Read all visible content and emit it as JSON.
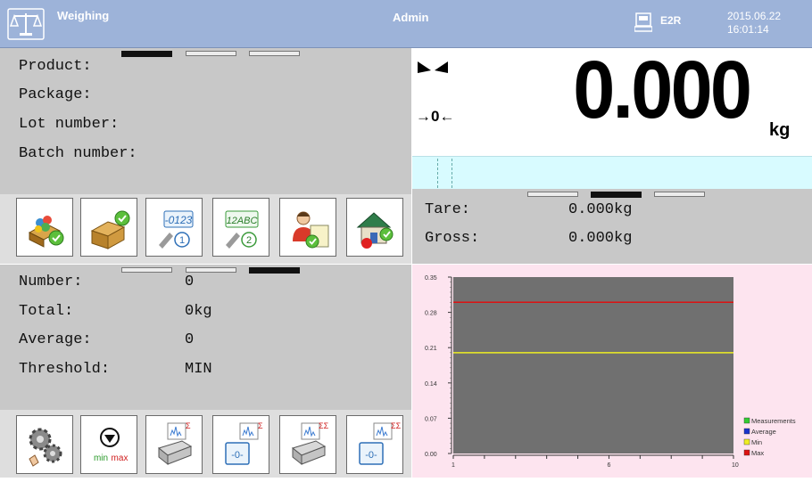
{
  "header": {
    "title": "Weighing",
    "user": "Admin",
    "device": "E2R",
    "date": "2015.06.22",
    "time": "16:01:14"
  },
  "product_panel": {
    "labels": [
      "Product:",
      "Package:",
      "Lot number:",
      "Batch number:"
    ],
    "values": [
      "",
      "",
      "",
      ""
    ]
  },
  "weight": {
    "value": "0.000",
    "unit": "kg",
    "zero_indicator": "→0←"
  },
  "tare_panel": {
    "tare_label": "Tare:",
    "tare_value": "0.000kg",
    "gross_label": "Gross:",
    "gross_value": "0.000kg"
  },
  "stats_panel": {
    "number_label": "Number:",
    "number_value": "0",
    "total_label": "Total:",
    "total_value": "0kg",
    "average_label": "Average:",
    "average_value": "0",
    "threshold_label": "Threshold:",
    "threshold_value": "MIN"
  },
  "buttons_top": [
    "database-check-icon",
    "package-check-icon",
    "tool-numeric-1-icon",
    "tool-alphanumeric-2-icon",
    "operator-document-icon",
    "home-check-icon"
  ],
  "buttons_bottom": [
    "settings-gears-icon",
    "min-max-threshold-icon",
    "print-sum-icon",
    "zero-sum-icon",
    "print-double-sum-icon",
    "zero-double-sum-icon"
  ],
  "minmax_text": {
    "min": "min",
    "max": "max"
  },
  "button_text": {
    "code1": "-0123",
    "code2": "12ABC",
    "sub1": "1",
    "sub2": "2",
    "zero": "-0-",
    "sigma": "Σ",
    "sigma2": "ΣΣ"
  },
  "chart_data": {
    "type": "line",
    "x_ticks": [
      "1",
      "6",
      "10"
    ],
    "xlim": [
      1,
      10
    ],
    "y_ticks": [
      "0.35",
      "0.28",
      "0.21",
      "0.14",
      "0.07",
      "0.00"
    ],
    "ylim": [
      0,
      0.35
    ],
    "series": [
      {
        "name": "Measurements",
        "color": "#33cc33",
        "values": []
      },
      {
        "name": "Average",
        "color": "#1a33cc",
        "values": []
      },
      {
        "name": "Min",
        "color": "#eeee22",
        "values": [
          0.2,
          0.2
        ]
      },
      {
        "name": "Max",
        "color": "#dd1111",
        "values": [
          0.3,
          0.3
        ]
      }
    ],
    "plot_background": "#707070"
  }
}
